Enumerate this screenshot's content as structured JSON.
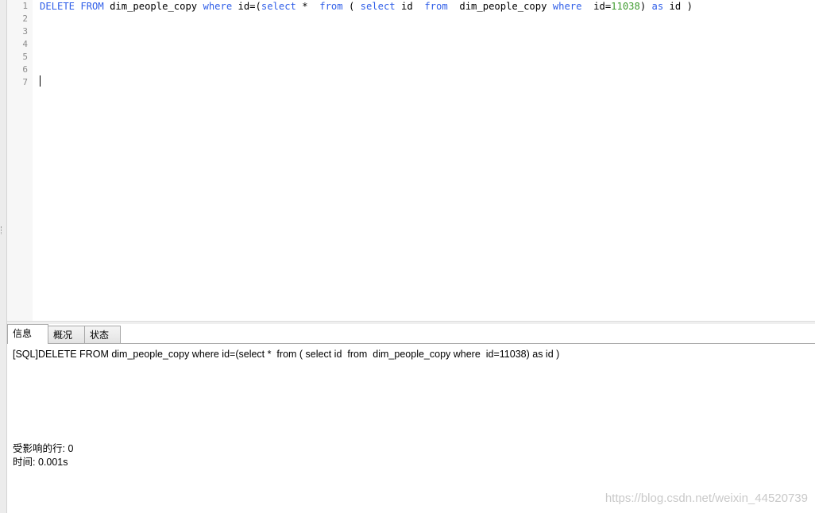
{
  "editor": {
    "line_numbers": [
      "1",
      "2",
      "3",
      "4",
      "5",
      "6",
      "7"
    ],
    "line1_tokens": [
      {
        "text": "DELETE",
        "type": "kw"
      },
      {
        "text": " ",
        "type": "plain"
      },
      {
        "text": "FROM",
        "type": "kw"
      },
      {
        "text": " dim_people_copy ",
        "type": "plain"
      },
      {
        "text": "where",
        "type": "kw"
      },
      {
        "text": " id=(",
        "type": "plain"
      },
      {
        "text": "select",
        "type": "kw"
      },
      {
        "text": " *  ",
        "type": "plain"
      },
      {
        "text": "from",
        "type": "kw"
      },
      {
        "text": " ( ",
        "type": "plain"
      },
      {
        "text": "select",
        "type": "kw"
      },
      {
        "text": " id  ",
        "type": "plain"
      },
      {
        "text": "from",
        "type": "kw"
      },
      {
        "text": "  dim_people_copy ",
        "type": "plain"
      },
      {
        "text": "where",
        "type": "kw"
      },
      {
        "text": "  id=",
        "type": "plain"
      },
      {
        "text": "11038",
        "type": "num"
      },
      {
        "text": ") ",
        "type": "plain"
      },
      {
        "text": "as",
        "type": "kw"
      },
      {
        "text": " id )",
        "type": "plain"
      }
    ]
  },
  "tabs": [
    {
      "label": "信息",
      "active": true
    },
    {
      "label": "概况",
      "active": false
    },
    {
      "label": "状态",
      "active": false
    }
  ],
  "messages": {
    "sql": "[SQL]DELETE FROM dim_people_copy where id=(select *  from ( select id  from  dim_people_copy where  id=11038) as id )",
    "affected_rows": "受影响的行: 0",
    "time": "时间: 0.001s"
  },
  "watermark": "https://blog.csdn.net/weixin_44520739",
  "colors": {
    "keyword": "#2f5ee8",
    "number": "#3f9b2f",
    "line_number": "#8c8c8c"
  }
}
